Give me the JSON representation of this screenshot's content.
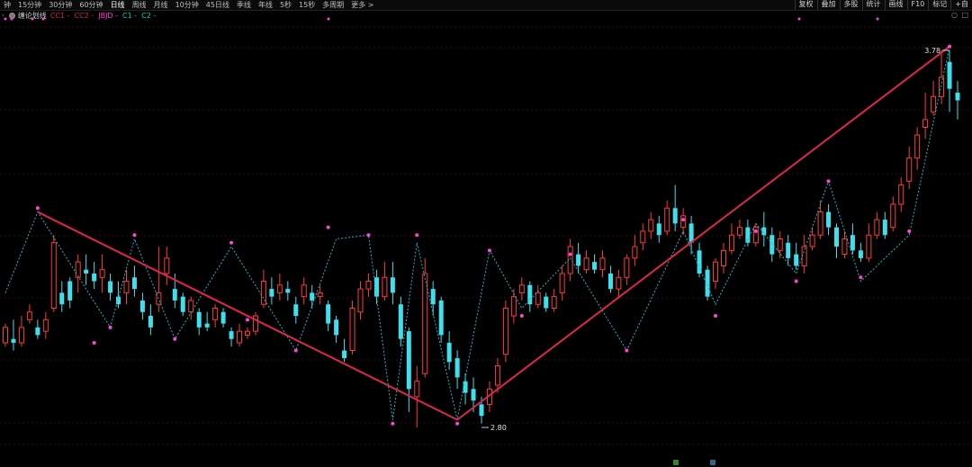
{
  "toolbar": {
    "periods": [
      "钟",
      "15分钟",
      "30分钟",
      "60分钟",
      "日线",
      "周线",
      "月线",
      "10分钟",
      "45日线",
      "季线",
      "年线",
      "5秒",
      "15秒",
      "多周期"
    ],
    "active_period": "日线",
    "more": "更多 >",
    "tools": [
      "复权",
      "叠加",
      "多股",
      "统计",
      "画线",
      "F10",
      "标记",
      "+自"
    ]
  },
  "indicator": {
    "name": "缠论划线",
    "items": [
      {
        "label": "CC1 -",
        "color": "#d21e5a"
      },
      {
        "label": "CC2 -",
        "color": "#d21e5a"
      },
      {
        "label": "JBJD -",
        "color": "#ff3bd2"
      },
      {
        "label": "C1 -",
        "color": "#00c8c8"
      },
      {
        "label": "C2 -",
        "color": "#00c8c8"
      }
    ]
  },
  "colors": {
    "up": "#ff3b3b",
    "down": "#3ee0ee",
    "trend": "#e0264e",
    "stroke": "#1fb8c8",
    "dot": "#ff44dd"
  },
  "chart_data": {
    "type": "candlestick",
    "ylim": [
      2.73,
      3.85
    ],
    "annotations": [
      {
        "label": "3.78",
        "value": 3.78,
        "index": 117
      },
      {
        "label": "2.80",
        "value": 2.8,
        "index": 59
      }
    ],
    "candles": [
      [
        3.02,
        3.06,
        3.07,
        3.01
      ],
      [
        3.03,
        3.02,
        3.08,
        3.0
      ],
      [
        3.02,
        3.06,
        3.09,
        3.01
      ],
      [
        3.08,
        3.1,
        3.12,
        3.07
      ],
      [
        3.06,
        3.04,
        3.08,
        3.03
      ],
      [
        3.05,
        3.08,
        3.1,
        3.03
      ],
      [
        3.11,
        3.28,
        3.3,
        3.1
      ],
      [
        3.15,
        3.12,
        3.18,
        3.1
      ],
      [
        3.18,
        3.13,
        3.19,
        3.11
      ],
      [
        3.19,
        3.23,
        3.25,
        3.15
      ],
      [
        3.21,
        3.2,
        3.25,
        3.17
      ],
      [
        3.2,
        3.18,
        3.23,
        3.16
      ],
      [
        3.19,
        3.21,
        3.25,
        3.15
      ],
      [
        3.18,
        3.15,
        3.2,
        3.13
      ],
      [
        3.14,
        3.12,
        3.18,
        3.11
      ],
      [
        3.15,
        3.18,
        3.21,
        3.12
      ],
      [
        3.19,
        3.16,
        3.22,
        3.14
      ],
      [
        3.13,
        3.1,
        3.15,
        3.08
      ],
      [
        3.09,
        3.06,
        3.12,
        3.04
      ],
      [
        3.12,
        3.15,
        3.27,
        3.1
      ],
      [
        3.2,
        3.24,
        3.27,
        3.17
      ],
      [
        3.16,
        3.13,
        3.2,
        3.11
      ],
      [
        3.14,
        3.1,
        3.15,
        3.09
      ],
      [
        3.1,
        3.13,
        3.14,
        3.08
      ],
      [
        3.1,
        3.06,
        3.11,
        3.04
      ],
      [
        3.07,
        3.06,
        3.1,
        3.05
      ],
      [
        3.08,
        3.11,
        3.12,
        3.06
      ],
      [
        3.1,
        3.07,
        3.11,
        3.06
      ],
      [
        3.05,
        3.03,
        3.06,
        3.01
      ],
      [
        3.02,
        3.05,
        3.07,
        3.01
      ],
      [
        3.04,
        3.05,
        3.06,
        3.03
      ],
      [
        3.05,
        3.09,
        3.1,
        3.04
      ],
      [
        3.12,
        3.18,
        3.21,
        3.11
      ],
      [
        3.16,
        3.14,
        3.19,
        3.12
      ],
      [
        3.15,
        3.17,
        3.2,
        3.13
      ],
      [
        3.16,
        3.15,
        3.18,
        3.13
      ],
      [
        3.12,
        3.09,
        3.14,
        3.07
      ],
      [
        3.14,
        3.17,
        3.19,
        3.12
      ],
      [
        3.15,
        3.13,
        3.17,
        3.11
      ],
      [
        3.14,
        3.15,
        3.17,
        3.12
      ],
      [
        3.12,
        3.07,
        3.13,
        3.05
      ],
      [
        3.08,
        3.04,
        3.09,
        3.02
      ],
      [
        3.0,
        2.98,
        3.03,
        2.97
      ],
      [
        3.0,
        3.11,
        3.13,
        2.99
      ],
      [
        3.1,
        3.16,
        3.18,
        3.08
      ],
      [
        3.16,
        3.18,
        3.2,
        3.14
      ],
      [
        3.19,
        3.14,
        3.21,
        3.12
      ],
      [
        3.14,
        3.19,
        3.23,
        3.13
      ],
      [
        3.19,
        3.15,
        3.23,
        3.12
      ],
      [
        3.12,
        3.03,
        3.14,
        3.01
      ],
      [
        3.05,
        2.9,
        3.06,
        2.84
      ],
      [
        2.88,
        2.92,
        2.96,
        2.8
      ],
      [
        2.94,
        3.2,
        3.24,
        2.93
      ],
      [
        3.16,
        3.12,
        3.18,
        3.09
      ],
      [
        3.13,
        3.04,
        3.14,
        3.02
      ],
      [
        3.02,
        2.97,
        3.05,
        2.95
      ],
      [
        2.98,
        2.93,
        3.0,
        2.9
      ],
      [
        2.92,
        2.89,
        2.94,
        2.86
      ],
      [
        2.9,
        2.87,
        2.93,
        2.84
      ],
      [
        2.86,
        2.83,
        2.88,
        2.81
      ],
      [
        2.86,
        2.9,
        2.92,
        2.84
      ],
      [
        2.91,
        2.96,
        2.98,
        2.89
      ],
      [
        2.99,
        3.11,
        3.13,
        2.97
      ],
      [
        3.09,
        3.14,
        3.16,
        3.07
      ],
      [
        3.15,
        3.17,
        3.19,
        3.13
      ],
      [
        3.17,
        3.12,
        3.18,
        3.1
      ],
      [
        3.12,
        3.15,
        3.17,
        3.11
      ],
      [
        3.14,
        3.11,
        3.15,
        3.1
      ],
      [
        3.11,
        3.14,
        3.16,
        3.1
      ],
      [
        3.15,
        3.2,
        3.22,
        3.13
      ],
      [
        3.2,
        3.27,
        3.29,
        3.18
      ],
      [
        3.25,
        3.22,
        3.28,
        3.2
      ],
      [
        3.21,
        3.24,
        3.26,
        3.2
      ],
      [
        3.23,
        3.21,
        3.25,
        3.2
      ],
      [
        3.21,
        3.24,
        3.26,
        3.19
      ],
      [
        3.2,
        3.16,
        3.22,
        3.15
      ],
      [
        3.16,
        3.19,
        3.21,
        3.14
      ],
      [
        3.19,
        3.24,
        3.25,
        3.17
      ],
      [
        3.24,
        3.27,
        3.3,
        3.22
      ],
      [
        3.28,
        3.31,
        3.33,
        3.26
      ],
      [
        3.31,
        3.34,
        3.36,
        3.29
      ],
      [
        3.33,
        3.3,
        3.35,
        3.28
      ],
      [
        3.31,
        3.37,
        3.39,
        3.3
      ],
      [
        3.37,
        3.33,
        3.43,
        3.31
      ],
      [
        3.32,
        3.35,
        3.37,
        3.3
      ],
      [
        3.33,
        3.28,
        3.35,
        3.25
      ],
      [
        3.26,
        3.2,
        3.28,
        3.19
      ],
      [
        3.21,
        3.14,
        3.22,
        3.13
      ],
      [
        3.18,
        3.23,
        3.24,
        3.16
      ],
      [
        3.22,
        3.26,
        3.28,
        3.2
      ],
      [
        3.26,
        3.3,
        3.33,
        3.25
      ],
      [
        3.3,
        3.32,
        3.34,
        3.29
      ],
      [
        3.32,
        3.28,
        3.34,
        3.27
      ],
      [
        3.28,
        3.32,
        3.33,
        3.27
      ],
      [
        3.32,
        3.3,
        3.36,
        3.27
      ],
      [
        3.3,
        3.25,
        3.32,
        3.23
      ],
      [
        3.26,
        3.29,
        3.31,
        3.24
      ],
      [
        3.28,
        3.24,
        3.3,
        3.22
      ],
      [
        3.25,
        3.22,
        3.28,
        3.21
      ],
      [
        3.22,
        3.27,
        3.3,
        3.2
      ],
      [
        3.27,
        3.3,
        3.32,
        3.26
      ],
      [
        3.3,
        3.36,
        3.39,
        3.29
      ],
      [
        3.36,
        3.32,
        3.38,
        3.3
      ],
      [
        3.32,
        3.27,
        3.33,
        3.24
      ],
      [
        3.25,
        3.29,
        3.31,
        3.24
      ],
      [
        3.3,
        3.26,
        3.33,
        3.25
      ],
      [
        3.26,
        3.24,
        3.28,
        3.23
      ],
      [
        3.24,
        3.3,
        3.33,
        3.23
      ],
      [
        3.3,
        3.34,
        3.36,
        3.29
      ],
      [
        3.34,
        3.3,
        3.36,
        3.29
      ],
      [
        3.32,
        3.38,
        3.4,
        3.31
      ],
      [
        3.38,
        3.43,
        3.45,
        3.36
      ],
      [
        3.44,
        3.5,
        3.53,
        3.42
      ],
      [
        3.5,
        3.56,
        3.58,
        3.47
      ],
      [
        3.58,
        3.6,
        3.67,
        3.55
      ],
      [
        3.62,
        3.66,
        3.7,
        3.61
      ],
      [
        3.66,
        3.71,
        3.78,
        3.64
      ],
      [
        3.75,
        3.68,
        3.78,
        3.62
      ],
      [
        3.67,
        3.65,
        3.7,
        3.6
      ]
    ],
    "strokes": [
      [
        0,
        3.15
      ],
      [
        4,
        3.36
      ],
      [
        13,
        3.06
      ],
      [
        16,
        3.29
      ],
      [
        21,
        3.03
      ],
      [
        28,
        3.27
      ],
      [
        36,
        3.0
      ],
      [
        41,
        3.29
      ],
      [
        45,
        3.3
      ],
      [
        48,
        2.82
      ],
      [
        51,
        3.28
      ],
      [
        56,
        2.82
      ],
      [
        60,
        3.26
      ],
      [
        64,
        3.11
      ],
      [
        70,
        3.24
      ],
      [
        77,
        3.0
      ],
      [
        84,
        3.31
      ],
      [
        88,
        3.12
      ],
      [
        93,
        3.33
      ],
      [
        98,
        3.2
      ],
      [
        102,
        3.44
      ],
      [
        106,
        3.18
      ],
      [
        112,
        3.3
      ],
      [
        117,
        3.79
      ]
    ],
    "trend_lines": [
      [
        [
          4,
          3.36
        ],
        [
          56,
          2.82
        ]
      ],
      [
        [
          56,
          2.82
        ],
        [
          117,
          3.79
        ]
      ]
    ],
    "extreme_dots": [
      [
        4,
        3.37
      ],
      [
        13,
        3.06
      ],
      [
        16,
        3.3
      ],
      [
        21,
        3.03
      ],
      [
        28,
        3.28
      ],
      [
        36,
        3.0
      ],
      [
        40,
        3.32
      ],
      [
        45,
        3.3
      ],
      [
        48,
        2.81
      ],
      [
        51,
        3.3
      ],
      [
        56,
        2.81
      ],
      [
        60,
        3.26
      ],
      [
        64,
        3.09
      ],
      [
        70,
        3.25
      ],
      [
        77,
        3.0
      ],
      [
        84,
        3.34
      ],
      [
        88,
        3.09
      ],
      [
        93,
        3.31
      ],
      [
        98,
        3.18
      ],
      [
        102,
        3.44
      ],
      [
        106,
        3.19
      ],
      [
        112,
        3.31
      ],
      [
        117,
        3.79
      ],
      [
        30,
        3.08
      ],
      [
        11,
        3.02
      ]
    ]
  }
}
